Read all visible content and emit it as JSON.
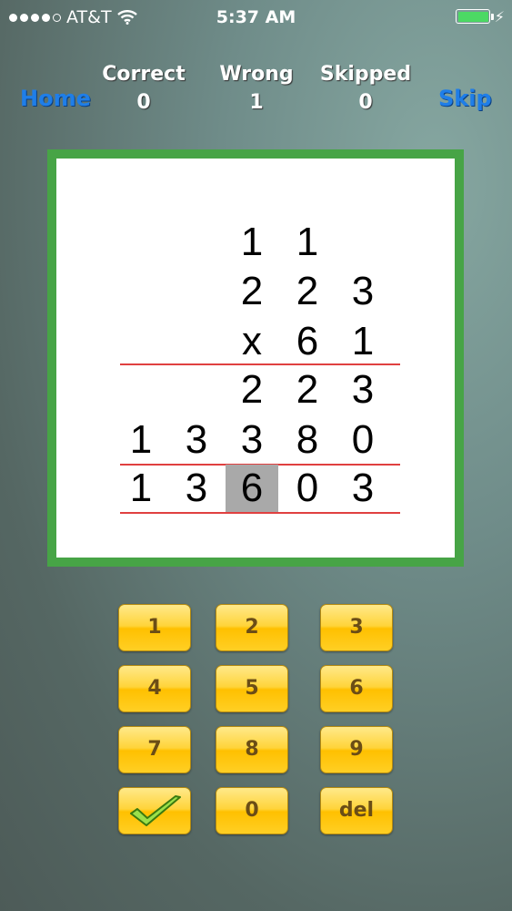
{
  "status_bar": {
    "carrier": "AT&T",
    "time": "5:37 AM"
  },
  "header": {
    "home_label": "Home",
    "skip_label": "Skip",
    "scores": [
      {
        "label": "Correct",
        "value": "0"
      },
      {
        "label": "Wrong",
        "value": "1"
      },
      {
        "label": "Skipped",
        "value": "0"
      }
    ]
  },
  "problem": {
    "carries": [
      "1",
      "1"
    ],
    "multiplicand": [
      "2",
      "2",
      "3"
    ],
    "multiplier": [
      "x",
      "6",
      "1"
    ],
    "partial_1": [
      "2",
      "2",
      "3"
    ],
    "partial_2": [
      "1",
      "3",
      "3",
      "8",
      "0"
    ],
    "answer": [
      "1",
      "3",
      "6",
      "0",
      "3"
    ],
    "active_answer_digit_index": 2
  },
  "keypad": {
    "keys": [
      "1",
      "2",
      "3",
      "4",
      "5",
      "6",
      "7",
      "8",
      "9",
      "",
      "0",
      "del"
    ],
    "check_icon": "check-icon",
    "accent_color": "#47a446"
  }
}
